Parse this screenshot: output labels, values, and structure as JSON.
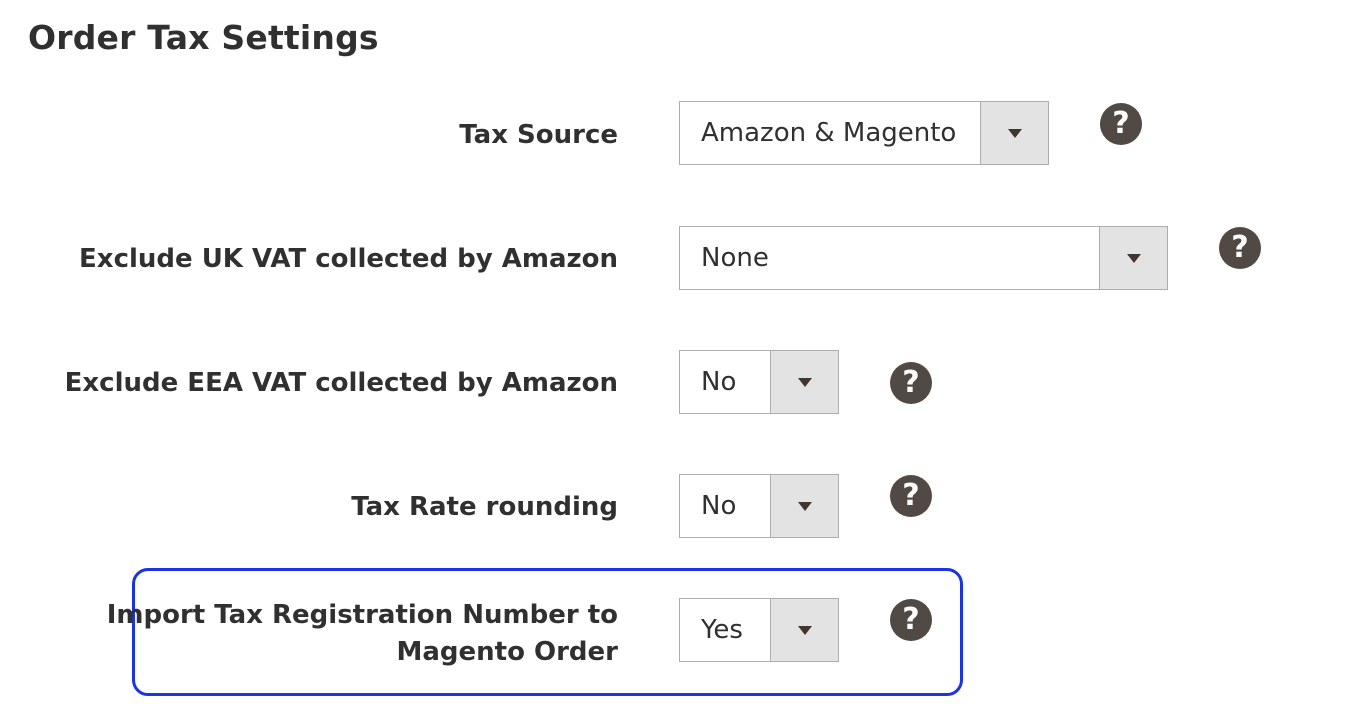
{
  "section": {
    "title": "Order Tax Settings"
  },
  "fields": [
    {
      "label": "Tax Source",
      "value": "Amazon & Magento",
      "help_icon": "question-circle-icon"
    },
    {
      "label": "Exclude UK VAT collected by Amazon",
      "value": "None",
      "help_icon": "question-circle-icon"
    },
    {
      "label": "Exclude EEA VAT collected by Amazon",
      "value": "No",
      "help_icon": "question-circle-icon"
    },
    {
      "label": "Tax Rate rounding",
      "value": "No",
      "help_icon": "question-circle-icon"
    },
    {
      "label_line1": "Import Tax Registration Number to",
      "label_line2": "Magento Order",
      "value": "Yes",
      "help_icon": "question-circle-icon"
    }
  ],
  "help_glyph": "?",
  "colors": {
    "highlight_border": "#1a35e0",
    "help_icon_bg": "#514943",
    "select_border": "#adadad",
    "select_arrow_bg": "#e3e3e3"
  }
}
